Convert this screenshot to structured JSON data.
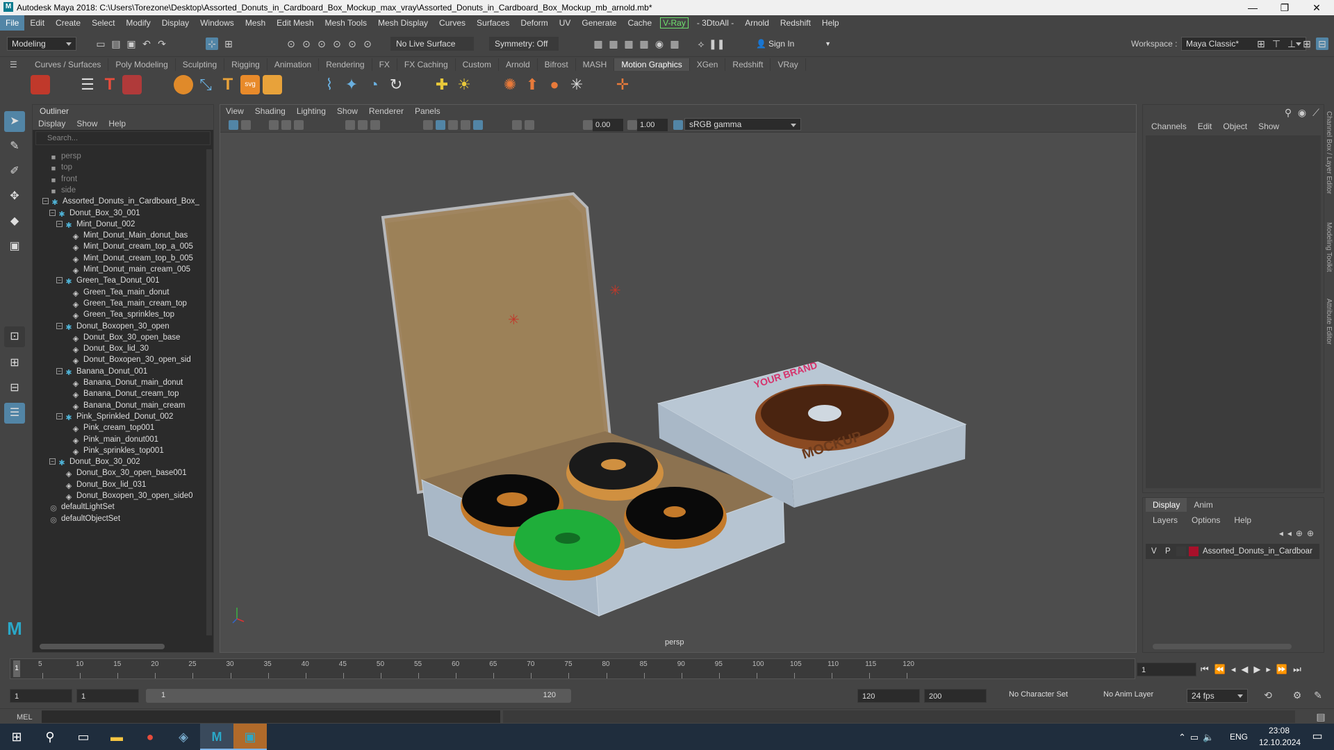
{
  "window": {
    "title": "Autodesk Maya 2018: C:\\Users\\Torezone\\Desktop\\Assorted_Donuts_in_Cardboard_Box_Mockup_max_vray\\Assorted_Donuts_in_Cardboard_Box_Mockup_mb_arnold.mb*",
    "logo": "M",
    "minimize": "—",
    "maximize": "❐",
    "close": "✕"
  },
  "menubar": [
    "File",
    "Edit",
    "Create",
    "Select",
    "Modify",
    "Display",
    "Windows",
    "Mesh",
    "Edit Mesh",
    "Mesh Tools",
    "Mesh Display",
    "Curves",
    "Surfaces",
    "Deform",
    "UV",
    "Generate",
    "Cache",
    "V-Ray",
    "- 3DtoAll -",
    "Arnold",
    "Redshift",
    "Help"
  ],
  "statusline": {
    "mode": "Modeling",
    "live_surface": "No Live Surface",
    "symmetry": "Symmetry: Off",
    "sign_in": "Sign In",
    "workspace_label": "Workspace :",
    "workspace": "Maya Classic*"
  },
  "shelf_tabs": [
    "Curves / Surfaces",
    "Poly Modeling",
    "Sculpting",
    "Rigging",
    "Animation",
    "Rendering",
    "FX",
    "FX Caching",
    "Custom",
    "Arnold",
    "Bifrost",
    "MASH",
    "Motion Graphics",
    "XGen",
    "Redshift",
    "VRay"
  ],
  "shelf_active": "Motion Graphics",
  "outliner": {
    "title": "Outliner",
    "menus": [
      "Display",
      "Show",
      "Help"
    ],
    "search_placeholder": "Search...",
    "rows": [
      {
        "label": "persp",
        "indent": 0,
        "icon": "camera-icon",
        "dim": true,
        "exp": ""
      },
      {
        "label": "top",
        "indent": 0,
        "icon": "camera-icon",
        "dim": true,
        "exp": ""
      },
      {
        "label": "front",
        "indent": 0,
        "icon": "camera-icon",
        "dim": true,
        "exp": ""
      },
      {
        "label": "side",
        "indent": 0,
        "icon": "camera-icon",
        "dim": true,
        "exp": ""
      },
      {
        "label": "Assorted_Donuts_in_Cardboard_Box_",
        "indent": 0,
        "icon": "group-icon",
        "dim": false,
        "exp": "−"
      },
      {
        "label": "Donut_Box_30_001",
        "indent": 1,
        "icon": "group-icon",
        "dim": false,
        "exp": "−"
      },
      {
        "label": "Mint_Donut_002",
        "indent": 2,
        "icon": "group-icon",
        "dim": false,
        "exp": "−"
      },
      {
        "label": "Mint_Donut_Main_donut_bas",
        "indent": 3,
        "icon": "mesh-icon",
        "dim": false,
        "exp": ""
      },
      {
        "label": "Mint_Donut_cream_top_a_005",
        "indent": 3,
        "icon": "mesh-icon",
        "dim": false,
        "exp": ""
      },
      {
        "label": "Mint_Donut_cream_top_b_005",
        "indent": 3,
        "icon": "mesh-icon",
        "dim": false,
        "exp": ""
      },
      {
        "label": "Mint_Donut_main_cream_005",
        "indent": 3,
        "icon": "mesh-icon",
        "dim": false,
        "exp": ""
      },
      {
        "label": "Green_Tea_Donut_001",
        "indent": 2,
        "icon": "group-icon",
        "dim": false,
        "exp": "−"
      },
      {
        "label": "Green_Tea_main_donut",
        "indent": 3,
        "icon": "mesh-icon",
        "dim": false,
        "exp": ""
      },
      {
        "label": "Green_Tea_main_cream_top",
        "indent": 3,
        "icon": "mesh-icon",
        "dim": false,
        "exp": ""
      },
      {
        "label": "Green_Tea_sprinkles_top",
        "indent": 3,
        "icon": "mesh-icon",
        "dim": false,
        "exp": ""
      },
      {
        "label": "Donut_Boxopen_30_open",
        "indent": 2,
        "icon": "group-icon",
        "dim": false,
        "exp": "−"
      },
      {
        "label": "Donut_Box_30_open_base",
        "indent": 3,
        "icon": "mesh-icon",
        "dim": false,
        "exp": ""
      },
      {
        "label": "Donut_Box_lid_30",
        "indent": 3,
        "icon": "mesh-icon",
        "dim": false,
        "exp": ""
      },
      {
        "label": "Donut_Boxopen_30_open_sid",
        "indent": 3,
        "icon": "mesh-icon",
        "dim": false,
        "exp": ""
      },
      {
        "label": "Banana_Donut_001",
        "indent": 2,
        "icon": "group-icon",
        "dim": false,
        "exp": "−"
      },
      {
        "label": "Banana_Donut_main_donut",
        "indent": 3,
        "icon": "mesh-icon",
        "dim": false,
        "exp": ""
      },
      {
        "label": "Banana_Donut_cream_top",
        "indent": 3,
        "icon": "mesh-icon",
        "dim": false,
        "exp": ""
      },
      {
        "label": "Banana_Donut_main_cream",
        "indent": 3,
        "icon": "mesh-icon",
        "dim": false,
        "exp": ""
      },
      {
        "label": "Pink_Sprinkled_Donut_002",
        "indent": 2,
        "icon": "group-icon",
        "dim": false,
        "exp": "−"
      },
      {
        "label": "Pink_cream_top001",
        "indent": 3,
        "icon": "mesh-icon",
        "dim": false,
        "exp": ""
      },
      {
        "label": "Pink_main_donut001",
        "indent": 3,
        "icon": "mesh-icon",
        "dim": false,
        "exp": ""
      },
      {
        "label": "Pink_sprinkles_top001",
        "indent": 3,
        "icon": "mesh-icon",
        "dim": false,
        "exp": ""
      },
      {
        "label": "Donut_Box_30_002",
        "indent": 1,
        "icon": "group-icon",
        "dim": false,
        "exp": "−"
      },
      {
        "label": "Donut_Box_30_open_base001",
        "indent": 2,
        "icon": "mesh-icon",
        "dim": false,
        "exp": ""
      },
      {
        "label": "Donut_Box_lid_031",
        "indent": 2,
        "icon": "mesh-icon",
        "dim": false,
        "exp": ""
      },
      {
        "label": "Donut_Boxopen_30_open_side0",
        "indent": 2,
        "icon": "mesh-icon",
        "dim": false,
        "exp": ""
      },
      {
        "label": "defaultLightSet",
        "indent": 0,
        "icon": "set-icon",
        "dim": false,
        "exp": ""
      },
      {
        "label": "defaultObjectSet",
        "indent": 0,
        "icon": "set-icon",
        "dim": false,
        "exp": ""
      }
    ]
  },
  "viewport": {
    "menus": [
      "View",
      "Shading",
      "Lighting",
      "Show",
      "Renderer",
      "Panels"
    ],
    "exposure": "0.00",
    "gamma": "1.00",
    "colorspace": "sRGB gamma",
    "camera_label": "persp",
    "brand_text_1": "YOUR BRAND",
    "brand_text_2": "MOCKUP"
  },
  "channelbox": {
    "menus": [
      "Channels",
      "Edit",
      "Object",
      "Show"
    ]
  },
  "layers": {
    "tabs": [
      "Display",
      "Anim"
    ],
    "menus": [
      "Layers",
      "Options",
      "Help"
    ],
    "layer_v": "V",
    "layer_p": "P",
    "layer_name": "Assorted_Donuts_in_Cardboar",
    "layer_color": "#a8102a"
  },
  "sidetabs": [
    "Channel Box / Layer Editor",
    "Modeling Toolkit",
    "Attribute Editor"
  ],
  "timeline": {
    "ticks": [
      "5",
      "10",
      "15",
      "20",
      "25",
      "30",
      "35",
      "40",
      "45",
      "50",
      "55",
      "60",
      "65",
      "70",
      "75",
      "80",
      "85",
      "90",
      "95",
      "100",
      "105",
      "110",
      "115",
      "120"
    ],
    "start_tick": "1",
    "current_frame": "1"
  },
  "range": {
    "start": "1",
    "playback_start": "1",
    "slider_start": "1",
    "slider_end": "120",
    "playback_end": "120",
    "end": "200",
    "character_set": "No Character Set",
    "anim_layer": "No Anim Layer",
    "fps": "24 fps"
  },
  "mel": "MEL",
  "taskbar": {
    "time": "23:08",
    "date": "12.10.2024",
    "lang": "ENG"
  }
}
